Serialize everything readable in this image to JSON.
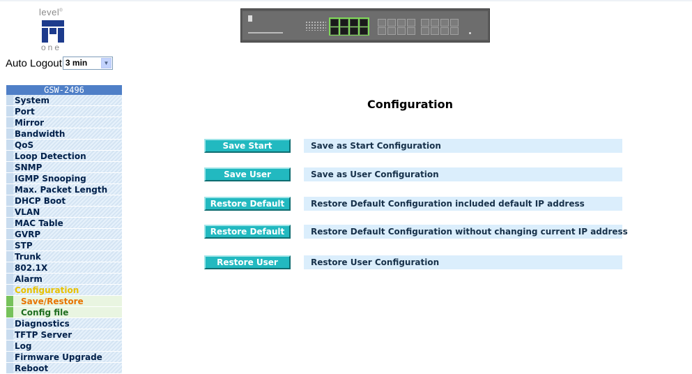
{
  "logo": {
    "top_text": "level",
    "bottom_text": "one"
  },
  "auto_logout": {
    "label": "Auto Logout",
    "selected": "3 min"
  },
  "banner": {
    "name": "switch-front-panel"
  },
  "menu": {
    "header": "GSW-2496",
    "items": [
      {
        "label": "System",
        "type": "main"
      },
      {
        "label": "Port",
        "type": "main"
      },
      {
        "label": "Mirror",
        "type": "main"
      },
      {
        "label": "Bandwidth",
        "type": "main"
      },
      {
        "label": "QoS",
        "type": "main"
      },
      {
        "label": "Loop Detection",
        "type": "main"
      },
      {
        "label": "SNMP",
        "type": "main"
      },
      {
        "label": "IGMP Snooping",
        "type": "main"
      },
      {
        "label": "Max. Packet Length",
        "type": "main"
      },
      {
        "label": "DHCP Boot",
        "type": "main"
      },
      {
        "label": "VLAN",
        "type": "main"
      },
      {
        "label": "MAC Table",
        "type": "main"
      },
      {
        "label": "GVRP",
        "type": "main"
      },
      {
        "label": "STP",
        "type": "main"
      },
      {
        "label": "Trunk",
        "type": "main"
      },
      {
        "label": "802.1X",
        "type": "main"
      },
      {
        "label": "Alarm",
        "type": "main"
      },
      {
        "label": "Configuration",
        "type": "active"
      },
      {
        "label": "Save/Restore",
        "type": "sub-current"
      },
      {
        "label": "Config file",
        "type": "sub"
      },
      {
        "label": "Diagnostics",
        "type": "main"
      },
      {
        "label": "TFTP Server",
        "type": "main"
      },
      {
        "label": "Log",
        "type": "main"
      },
      {
        "label": "Firmware Upgrade",
        "type": "main"
      },
      {
        "label": "Reboot",
        "type": "main"
      }
    ]
  },
  "main": {
    "title": "Configuration",
    "rows": [
      {
        "button": "Save Start",
        "description": "Save as Start Configuration"
      },
      {
        "button": "Save User",
        "description": "Save as User Configuration"
      },
      {
        "button": "Restore Default",
        "description": "Restore Default Configuration included default IP address"
      },
      {
        "button": "Restore Default",
        "description": "Restore Default Configuration without changing current IP address"
      },
      {
        "button": "Restore User",
        "description": "Restore User Configuration"
      }
    ]
  },
  "colors": {
    "button_bg": "#22b9c0",
    "desc_bg": "#dbeefc",
    "menu_header": "#4f7fc7",
    "active_item": "#e8c200",
    "current_sub": "#e87400"
  }
}
